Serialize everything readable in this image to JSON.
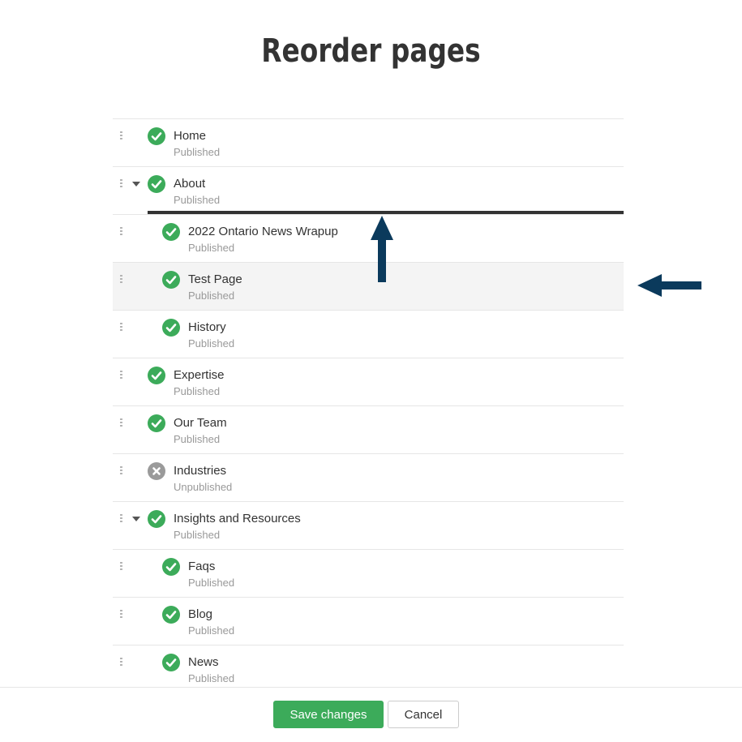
{
  "page": {
    "title": "Reorder pages"
  },
  "colors": {
    "published": "#3cab5a",
    "unpublished": "#9a9a9a",
    "arrow": "#0b3a5c",
    "drop_line": "#333333"
  },
  "pages": [
    {
      "name": "Home",
      "status": "Published",
      "level": 0,
      "expandable": false
    },
    {
      "name": "About",
      "status": "Published",
      "level": 0,
      "expandable": true
    },
    {
      "name": "2022 Ontario News Wrapup",
      "status": "Published",
      "level": 1,
      "expandable": false
    },
    {
      "name": "Test Page",
      "status": "Published",
      "level": 1,
      "expandable": false,
      "highlighted": true
    },
    {
      "name": "History",
      "status": "Published",
      "level": 1,
      "expandable": false
    },
    {
      "name": "Expertise",
      "status": "Published",
      "level": 0,
      "expandable": false
    },
    {
      "name": "Our Team",
      "status": "Published",
      "level": 0,
      "expandable": false
    },
    {
      "name": "Industries",
      "status": "Unpublished",
      "level": 0,
      "expandable": false
    },
    {
      "name": "Insights and Resources",
      "status": "Published",
      "level": 0,
      "expandable": true
    },
    {
      "name": "Faqs",
      "status": "Published",
      "level": 1,
      "expandable": false
    },
    {
      "name": "Blog",
      "status": "Published",
      "level": 1,
      "expandable": false
    },
    {
      "name": "News",
      "status": "Published",
      "level": 1,
      "expandable": false
    }
  ],
  "footer": {
    "save_label": "Save changes",
    "cancel_label": "Cancel"
  },
  "icons": {
    "drag": "drag-handle-icon",
    "expand": "caret-down-icon",
    "published": "check-circle-icon",
    "unpublished": "x-circle-icon"
  }
}
